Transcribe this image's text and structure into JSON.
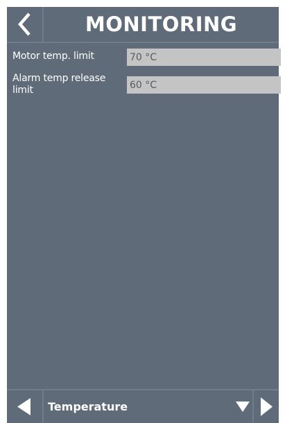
{
  "header": {
    "title": "MONITORING",
    "back_icon": "chevron-left-icon"
  },
  "settings": [
    {
      "label_line1": "Motor temp. limit",
      "label_line2": "",
      "value": "70 °C"
    },
    {
      "label_line1": "Alarm temp release",
      "label_line2": "limit",
      "value": "60 °C"
    }
  ],
  "footer": {
    "selected_category": "Temperature",
    "prev_icon": "triangle-left-icon",
    "next_icon": "triangle-right-icon",
    "dropdown_icon": "triangle-down-icon"
  },
  "colors": {
    "background": "#5f6b78",
    "divider": "#6f7c89",
    "field": "#c4c4c4",
    "text": "#ffffff"
  }
}
